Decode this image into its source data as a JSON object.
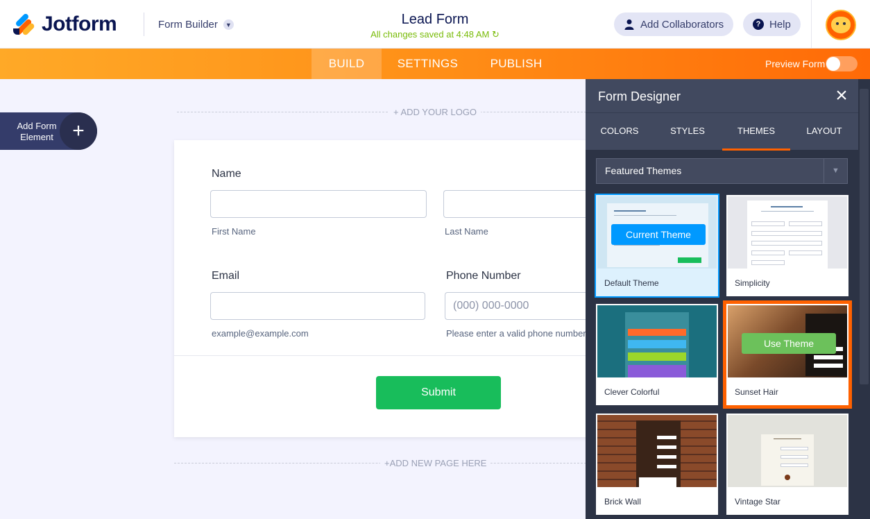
{
  "header": {
    "logo_text": "Jotform",
    "builder_label": "Form Builder",
    "form_title": "Lead Form",
    "saved_status": "All changes saved at 4:48 AM",
    "collaborators_label": "Add Collaborators",
    "help_label": "Help"
  },
  "nav": {
    "tabs": [
      "BUILD",
      "SETTINGS",
      "PUBLISH"
    ],
    "preview_label": "Preview Form"
  },
  "canvas": {
    "add_logo": "+ ADD YOUR LOGO",
    "add_element": "Add Form Element",
    "add_page": "+ADD NEW PAGE HERE"
  },
  "form": {
    "name_label": "Name",
    "first_name_sub": "First Name",
    "last_name_sub": "Last Name",
    "email_label": "Email",
    "email_sub": "example@example.com",
    "phone_label": "Phone Number",
    "phone_placeholder": "(000) 000-0000",
    "phone_sub": "Please enter a valid phone number.",
    "submit_label": "Submit"
  },
  "designer": {
    "title": "Form Designer",
    "tabs": [
      "COLORS",
      "STYLES",
      "THEMES",
      "LAYOUT"
    ],
    "active_tab": "THEMES",
    "select_value": "Featured Themes",
    "themes": [
      {
        "name": "Default Theme",
        "overlay": "Current Theme"
      },
      {
        "name": "Simplicity"
      },
      {
        "name": "Clever Colorful"
      },
      {
        "name": "Sunset Hair",
        "overlay": "Use Theme"
      },
      {
        "name": "Brick Wall"
      },
      {
        "name": "Vintage Star"
      }
    ]
  },
  "colors": {
    "brand_orange": "#ff6100",
    "submit_green": "#18bd5b",
    "saved_green": "#78bb07",
    "current_blue": "#0099ff",
    "panel_dark": "#2c3345"
  }
}
